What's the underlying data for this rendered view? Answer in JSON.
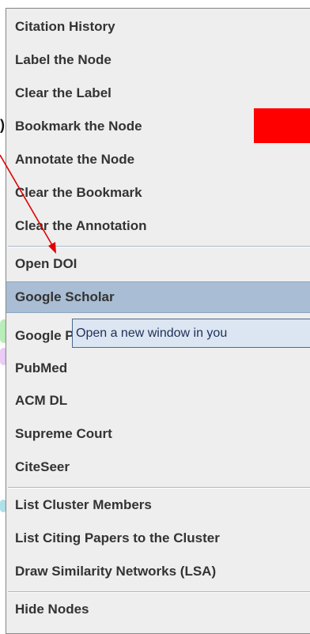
{
  "menu": {
    "items": [
      {
        "label": "Citation History"
      },
      {
        "label": "Label the Node"
      },
      {
        "label": "Clear the Label"
      },
      {
        "label": "Bookmark the Node"
      },
      {
        "label": "Annotate the Node"
      },
      {
        "label": "Clear the Bookmark"
      },
      {
        "label": "Clear the Annotation"
      },
      {
        "label": "Open DOI"
      },
      {
        "label": "Google Scholar"
      },
      {
        "label": "Google Pa"
      },
      {
        "label": "PubMed"
      },
      {
        "label": "ACM DL"
      },
      {
        "label": "Supreme Court"
      },
      {
        "label": "CiteSeer"
      },
      {
        "label": "List Cluster Members"
      },
      {
        "label": "List Citing Papers to the Cluster"
      },
      {
        "label": "Draw Similarity Networks (LSA)"
      },
      {
        "label": "Hide Nodes"
      }
    ],
    "highlighted": "Google Scholar"
  },
  "tooltip": {
    "text": "Open a new window in you"
  },
  "background_fragments": {
    "paren": ")"
  },
  "colors": {
    "highlight": "#a9bdd4",
    "tooltip_bg": "#dce6f2",
    "arrow": "#e00000",
    "marker": "#ff0000"
  }
}
